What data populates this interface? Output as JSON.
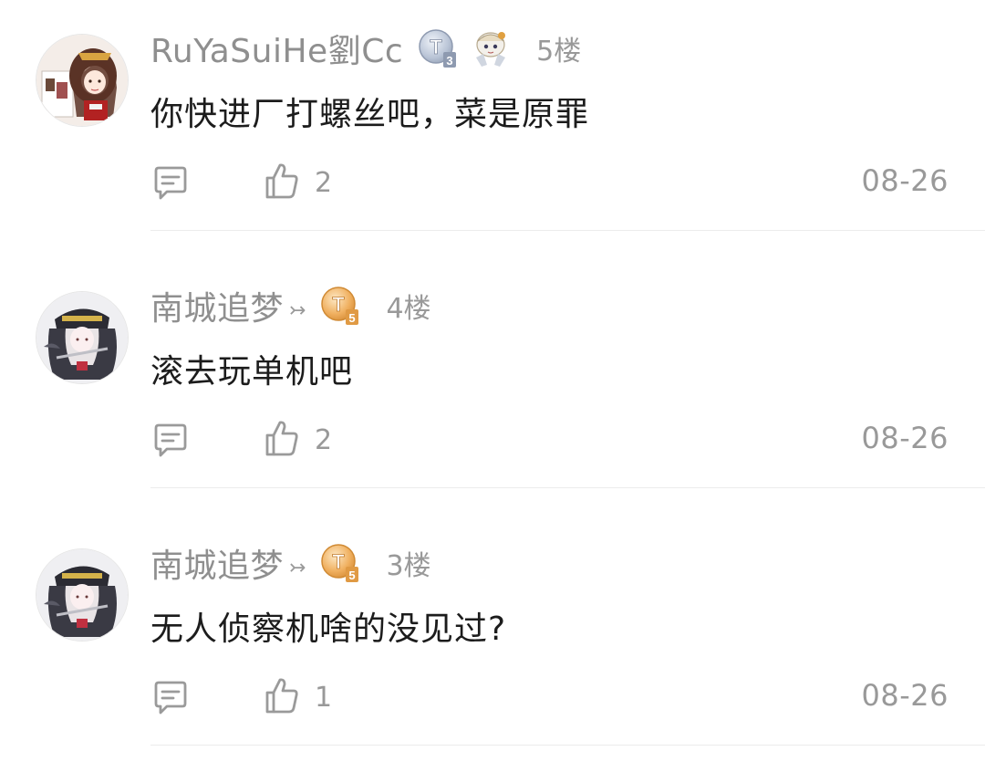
{
  "colors": {
    "username": "#8f8f8f",
    "meta": "#999999",
    "text": "#1c1c1c",
    "divider": "#ececec",
    "badge_gold": "#f0b060",
    "badge_silver": "#b9c4d6"
  },
  "comments": [
    {
      "username": "RuYaSuiHe劉Cc",
      "badge_level": "3",
      "badge_type": "silver",
      "has_extra_badge": true,
      "floor": "5楼",
      "content": "你快进厂打螺丝吧，菜是原罪",
      "likes": "2",
      "date": "08-26",
      "icons": [
        "avatar",
        "level-badge-icon",
        "character-badge-icon",
        "reply-icon",
        "thumbs-up-icon"
      ]
    },
    {
      "username": "南城追梦",
      "arrow": "↣",
      "badge_level": "5",
      "badge_type": "gold",
      "floor": "4楼",
      "content": "滚去玩单机吧",
      "likes": "2",
      "date": "08-26",
      "icons": [
        "avatar",
        "arrow-icon",
        "level-badge-icon",
        "reply-icon",
        "thumbs-up-icon"
      ]
    },
    {
      "username": "南城追梦",
      "arrow": "↣",
      "badge_level": "5",
      "badge_type": "gold",
      "floor": "3楼",
      "content": "无人侦察机啥的没见过?",
      "likes": "1",
      "date": "08-26",
      "icons": [
        "avatar",
        "arrow-icon",
        "level-badge-icon",
        "reply-icon",
        "thumbs-up-icon"
      ]
    }
  ]
}
